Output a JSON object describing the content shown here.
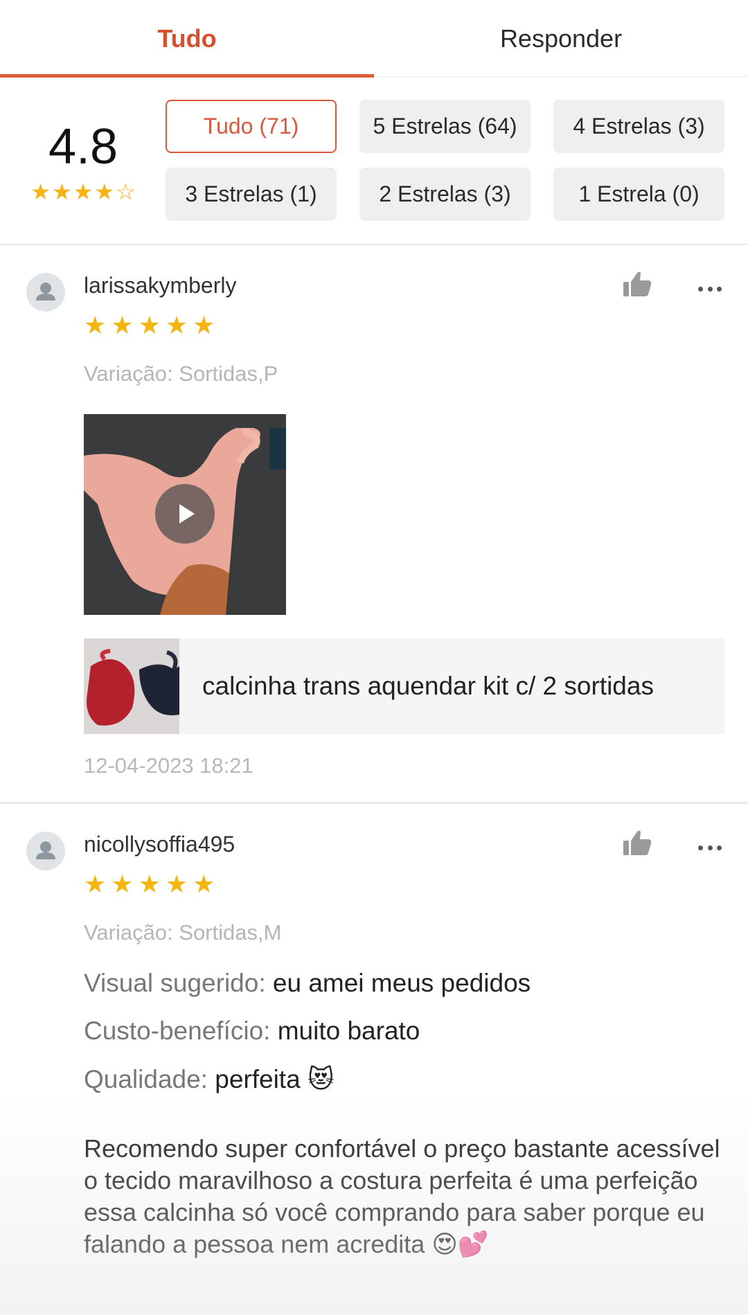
{
  "tabs": [
    {
      "label": "Tudo",
      "active": true
    },
    {
      "label": "Responder",
      "active": false
    }
  ],
  "summary": {
    "score": "4.8",
    "score_value": 4.8,
    "filters": [
      {
        "label": "Tudo (71)",
        "active": true
      },
      {
        "label": "5 Estrelas (64)",
        "active": false
      },
      {
        "label": "4 Estrelas (3)",
        "active": false
      },
      {
        "label": "3 Estrelas (1)",
        "active": false
      },
      {
        "label": "2 Estrelas (3)",
        "active": false
      },
      {
        "label": "1 Estrela (0)",
        "active": false
      }
    ]
  },
  "reviews": [
    {
      "username": "larissakymberly",
      "stars": 5,
      "variation": "Variação: Sortidas,P",
      "has_video": true,
      "product_name": "calcinha trans aquendar kit c/ 2 sortidas",
      "date": "12-04-2023 18:21"
    },
    {
      "username": "nicollysoffia495",
      "stars": 5,
      "variation": "Variação: Sortidas,M",
      "fields": [
        {
          "key": "Visual sugerido:",
          "value": "eu amei meus pedidos"
        },
        {
          "key": "Custo-benefício:",
          "value": "muito barato"
        },
        {
          "key": "Qualidade:",
          "value": "perfeita 😻"
        }
      ],
      "text": "Recomendo super confortável o preço bastante acessível o tecido maravilhoso a costura perfeita é uma perfeição essa calcinha só você comprando para saber porque eu falando a pessoa nem acredita 😍💕"
    }
  ],
  "icons": {
    "avatar": "user-avatar-icon",
    "like": "thumbs-up-icon",
    "more": "more-dots-icon",
    "play": "play-icon"
  },
  "colors": {
    "accent": "#d8583b",
    "star": "#f5b50f",
    "chip_bg": "#efefef"
  }
}
